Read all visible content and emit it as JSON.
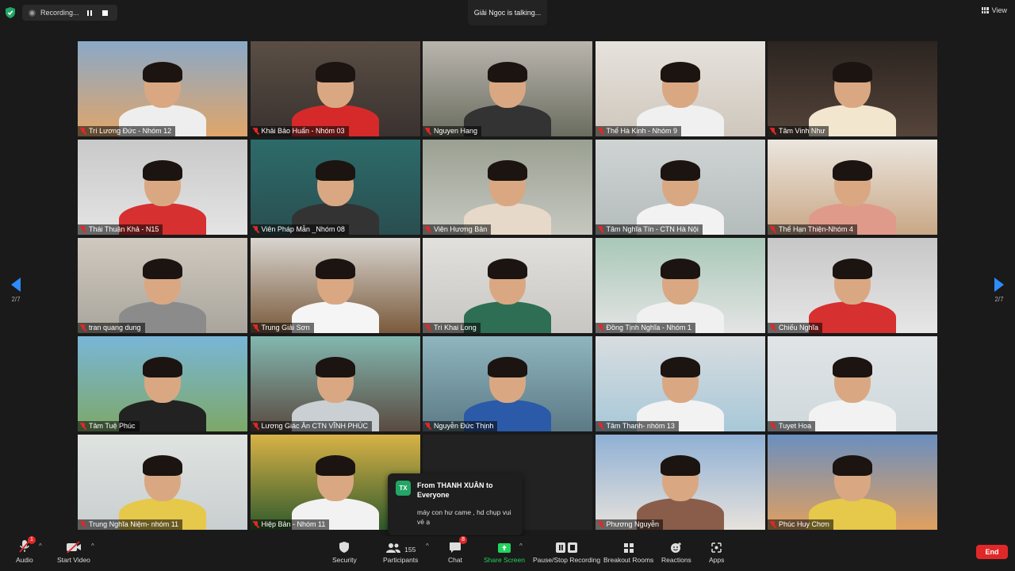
{
  "recording": {
    "label": "Recording...",
    "pause_icon": "pause-icon",
    "stop_icon": "stop-icon"
  },
  "active_speaker": "Giải Ngọc is talking...",
  "view": {
    "label": "View"
  },
  "pagination": {
    "left": "2/7",
    "right": "2/7"
  },
  "participants": [
    {
      "name": "Trí Lương Đức - Nhóm 12",
      "bg": "#8aa9c8",
      "bg2": "#e0a56a",
      "body": "#eeeeee"
    },
    {
      "name": "Khải Bảo Huấn - Nhóm 03",
      "bg": "#5a4e44",
      "bg2": "#3a3230",
      "body": "#d62a2a"
    },
    {
      "name": "Nguyen Hang",
      "bg": "#b9b5ae",
      "bg2": "#6b6d60",
      "body": "#333333"
    },
    {
      "name": "Thể Hà Kinh - Nhóm 9",
      "bg": "#e6e2dc",
      "bg2": "#cfc7bd",
      "body": "#f0f0f0"
    },
    {
      "name": "Tâm Vinh Như",
      "bg": "#2b2420",
      "bg2": "#55443a",
      "body": "#f2e6cf"
    },
    {
      "name": "Thái Thuận Khả - N15",
      "bg": "#c9c9c9",
      "bg2": "#e4e4e4",
      "body": "#d63030"
    },
    {
      "name": "Viên Pháp Mẫn _Nhóm 08",
      "bg": "#2c6b6a",
      "bg2": "#2a4e50",
      "body": "#333333"
    },
    {
      "name": "Viên Hương Bản",
      "bg": "#9aa092",
      "bg2": "#c6c8c0",
      "body": "#e7d9c9"
    },
    {
      "name": "Tâm Nghĩa Tín - CTN Hà Nội",
      "bg": "#cfd4d3",
      "bg2": "#b5bcbc",
      "body": "#f2f2f2"
    },
    {
      "name": "Thể Hạn Thiện-Nhóm 4",
      "bg": "#ebe6df",
      "bg2": "#c9a786",
      "body": "#e09a8a"
    },
    {
      "name": "tran quang dung",
      "bg": "#cfc9c0",
      "bg2": "#aaa59c",
      "body": "#8b8b8b"
    },
    {
      "name": "Trung Giải Sơn",
      "bg": "#d8d5d0",
      "bg2": "#7a5a3c",
      "body": "#f5f5f5"
    },
    {
      "name": "Trí Khai Long",
      "bg": "#e2e0dc",
      "bg2": "#c8c6c3",
      "body": "#2e6e55"
    },
    {
      "name": "Đồng Tịnh Nghĩa - Nhóm 1",
      "bg": "#a8c8b8",
      "bg2": "#e4e4e4",
      "body": "#f0f0f0"
    },
    {
      "name": "Chiếu Nghĩa",
      "bg": "#c7c7c7",
      "bg2": "#e6e6e6",
      "body": "#d63030"
    },
    {
      "name": "Tâm Tuệ Phúc",
      "bg": "#79b6d8",
      "bg2": "#7da868",
      "body": "#222222"
    },
    {
      "name": "Lương Giác Ân CTN VĨNH PHÚC",
      "bg": "#82b8b0",
      "bg2": "#5a4a40",
      "body": "#c9cfd3"
    },
    {
      "name": "Nguyễn Đức Thịnh",
      "bg": "#8fb5be",
      "bg2": "#5c7a86",
      "body": "#2b5aa8"
    },
    {
      "name": "Tâm Thanh- nhóm 13",
      "bg": "#d8dde0",
      "bg2": "#a8c8d8",
      "body": "#f2f2f2"
    },
    {
      "name": "Tuyet Hoa",
      "bg": "#e0e4e6",
      "bg2": "#cfd8dc",
      "body": "#f2f2f2"
    },
    {
      "name": "Trung Nghĩa Niệm- nhóm 11",
      "bg": "#dfe3e0",
      "bg2": "#c9ced0",
      "body": "#e6c84a"
    },
    {
      "name": "Hiệp Bản - Nhóm 11",
      "bg": "#d9b246",
      "bg2": "#2f5a2c",
      "body": "#f2f2f2"
    },
    {
      "name": "",
      "bg": "#222222",
      "bg2": "#222222",
      "body": "#222222"
    },
    {
      "name": "Phương Nguyễn",
      "bg": "#8fb0d4",
      "bg2": "#e7e2dc",
      "body": "#8a5d4a"
    },
    {
      "name": "Phúc Huy Chơn",
      "bg": "#6a8fbf",
      "bg2": "#e0a060",
      "body": "#e6c84a"
    }
  ],
  "chat_popup": {
    "avatar": "TX",
    "from": "From THANH XUÂN to Everyone",
    "message": "máy con hư came , hd chụp vui vẻ ạ"
  },
  "toolbar": {
    "audio": "Audio",
    "audio_badge": "1",
    "start_video": "Start Video",
    "security": "Security",
    "participants": "Participants",
    "participants_count": "155",
    "chat": "Chat",
    "chat_badge": "8",
    "share_screen": "Share Screen",
    "pause_stop_recording": "Pause/Stop Recording",
    "breakout_rooms": "Breakout Rooms",
    "reactions": "Reactions",
    "apps": "Apps",
    "end": "End"
  }
}
